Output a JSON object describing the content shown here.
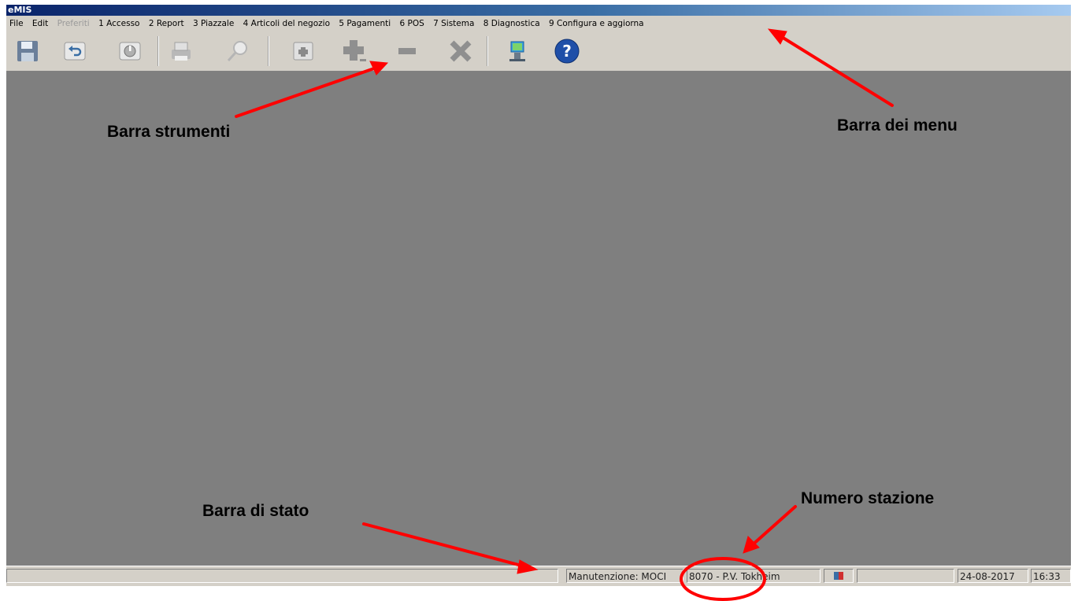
{
  "window": {
    "title": "eMIS"
  },
  "menu": [
    {
      "label": "File",
      "enabled": true
    },
    {
      "label": "Edit",
      "enabled": true
    },
    {
      "label": "Preferiti",
      "enabled": false
    },
    {
      "label": "1 Accesso",
      "enabled": true
    },
    {
      "label": "2 Report",
      "enabled": true
    },
    {
      "label": "3 Piazzale",
      "enabled": true
    },
    {
      "label": "4 Articoli del negozio",
      "enabled": true
    },
    {
      "label": "5 Pagamenti",
      "enabled": true
    },
    {
      "label": "6 POS",
      "enabled": true
    },
    {
      "label": "7 Sistema",
      "enabled": true
    },
    {
      "label": "8 Diagnostica",
      "enabled": true
    },
    {
      "label": "9 Configura e aggiorna",
      "enabled": true
    }
  ],
  "toolbar": {
    "buttons": [
      "save-icon",
      "undo-icon",
      "power-icon",
      "print-icon",
      "search-icon",
      "new-record-icon",
      "add-icon",
      "remove-icon",
      "delete-icon",
      "network-icon",
      "help-icon"
    ]
  },
  "statusbar": {
    "mode": "Manutenzione: MOCI",
    "station": "8070 - P.V. Tokheim",
    "date": "24-08-2017",
    "time": "16:33"
  },
  "annotations": {
    "toolbar": "Barra strumenti",
    "menubar": "Barra dei menu",
    "statusbar": "Barra di stato",
    "station": "Numero stazione"
  },
  "colors": {
    "annotation": "#ff0000",
    "workspace": "#7f7f7f",
    "chrome": "#d4d0c8",
    "help": "#1f4fa8"
  }
}
